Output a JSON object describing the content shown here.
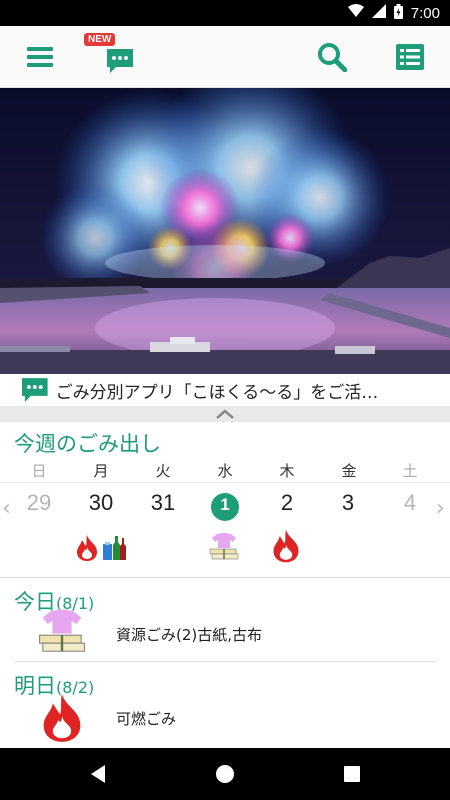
{
  "status_bar": {
    "time": "7:00",
    "icons": [
      "wifi-icon",
      "signal-icon",
      "battery-icon"
    ]
  },
  "app_bar": {
    "new_badge": "NEW",
    "icons": [
      "menu-icon",
      "chat-icon",
      "search-icon",
      "list-icon"
    ],
    "accent": "#1e9e78"
  },
  "hero": {
    "description_icon": "fireworks-image"
  },
  "ticker": {
    "text": "ごみ分別アプリ「こほくる〜る」をご活…"
  },
  "week": {
    "title": "今週のごみ出し",
    "days": [
      "日",
      "月",
      "火",
      "水",
      "木",
      "金",
      "土"
    ],
    "dates": [
      "29",
      "30",
      "31",
      "1",
      "2",
      "3",
      "4"
    ],
    "today_index": 3,
    "garbage": [
      {
        "day": "月",
        "icons": [
          "burnable-fire-icon",
          "bottles-cans-icon"
        ]
      },
      {
        "day": "水",
        "icons": [
          "paper-cloth-icon"
        ]
      },
      {
        "day": "木",
        "icons": [
          "burnable-fire-icon"
        ]
      }
    ]
  },
  "schedule": [
    {
      "heading": "今日",
      "date": "(8/1)",
      "icon": "paper-cloth-icon",
      "description": "資源ごみ(2)古紙,古布"
    },
    {
      "heading": "明日",
      "date": "(8/2)",
      "icon": "burnable-fire-icon",
      "description": "可燃ごみ"
    }
  ],
  "nav_bar": {
    "icons": [
      "back-icon",
      "home-icon",
      "recents-icon"
    ]
  }
}
